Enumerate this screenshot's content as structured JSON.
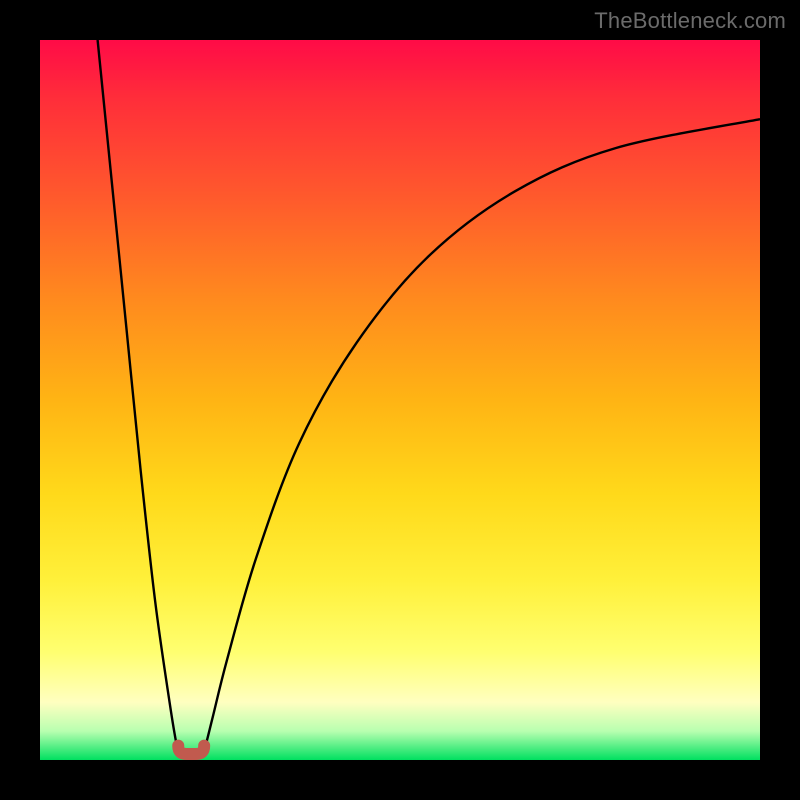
{
  "watermark": "TheBottleneck.com",
  "chart_data": {
    "type": "line",
    "title": "",
    "xlabel": "",
    "ylabel": "",
    "xlim": [
      0,
      100
    ],
    "ylim": [
      0,
      100
    ],
    "grid": false,
    "legend": false,
    "series": [
      {
        "name": "left-branch",
        "x": [
          8,
          10,
          12,
          14,
          16,
          18,
          19.0,
          19.5
        ],
        "y": [
          100,
          80,
          60,
          40,
          22,
          8,
          2,
          0.5
        ]
      },
      {
        "name": "right-branch",
        "x": [
          22.5,
          23,
          24,
          26,
          30,
          36,
          44,
          54,
          66,
          80,
          100
        ],
        "y": [
          0.5,
          2,
          6,
          14,
          28,
          44,
          58,
          70,
          79,
          85,
          89
        ]
      },
      {
        "name": "marker-band",
        "x": [
          19.2,
          22.8
        ],
        "y": [
          2.0,
          2.0
        ],
        "note": "reddish curved marker at trough"
      }
    ],
    "colors": {
      "curve": "#000000",
      "marker": "#c15a4e",
      "gradient_top": "#ff0b47",
      "gradient_bottom": "#00e060"
    }
  }
}
